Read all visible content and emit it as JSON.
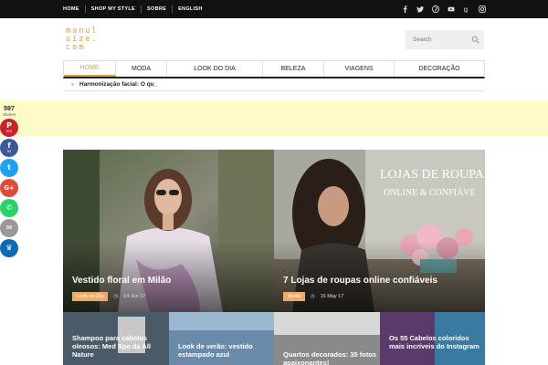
{
  "top_nav": {
    "items": [
      "HOME",
      "SHOP MY STYLE",
      "SOBRE",
      "ENGLISH"
    ],
    "social_icons": [
      "facebook-icon",
      "twitter-icon",
      "pinterest-icon",
      "youtube-icon",
      "googleplus-icon",
      "instagram-icon"
    ]
  },
  "header": {
    "logo_text": "manuluize.com",
    "search_placeholder": "Search"
  },
  "main_nav": {
    "items": [
      "HOME",
      "MODA",
      "LOOK DO DIA",
      "BELEZA",
      "VIAGENS",
      "DECORAÇÃO"
    ],
    "active": "HOME"
  },
  "ticker": {
    "text": "Harmonização facial: O qu_"
  },
  "share_bar": {
    "count": "597",
    "count_label": "Shares",
    "buttons": [
      {
        "icon": "pinterest-icon",
        "glyph": "P",
        "count": "513",
        "color": "#cb2027"
      },
      {
        "icon": "facebook-icon",
        "glyph": "f",
        "count": "83",
        "color": "#3b5998"
      },
      {
        "icon": "twitter-icon",
        "glyph": "t",
        "count": "",
        "color": "#1da1f2"
      },
      {
        "icon": "googleplus-icon",
        "glyph": "G+",
        "count": "",
        "color": "#dd4b39"
      },
      {
        "icon": "whatsapp-icon",
        "glyph": "✆",
        "count": "",
        "color": "#25d366"
      },
      {
        "icon": "email-icon",
        "glyph": "✉",
        "count": "",
        "color": "#999999"
      },
      {
        "icon": "sumome-icon",
        "glyph": "♛",
        "count": "",
        "color": "#0e6ab5"
      }
    ]
  },
  "featured": [
    {
      "title": "Vestido floral em Milão",
      "category": "Look do Dia",
      "date": "14 Jun 17"
    },
    {
      "title": "7 Lojas de roupas online confiáveis",
      "category": "Moda",
      "date": "16 May 17",
      "image_text_1": "LOJAS DE ROUPA",
      "image_text_2": "ONLINE & CONFIÁVE"
    }
  ],
  "small_posts": [
    {
      "title": "Shampoo para cabelos oleosos: Med Spa da All Nature"
    },
    {
      "title": "Look de verão: vestido estampado azul"
    },
    {
      "title": "Quartos decorados: 35 fotos apaixonantes!"
    },
    {
      "title": "Os 55 Cabelos coloridos mais incríveis do Instagram"
    }
  ],
  "colors": {
    "accent": "#e2a03a",
    "topbar": "#111111",
    "adbar": "#fffbc9",
    "category_badge": "#f0ab6b"
  }
}
